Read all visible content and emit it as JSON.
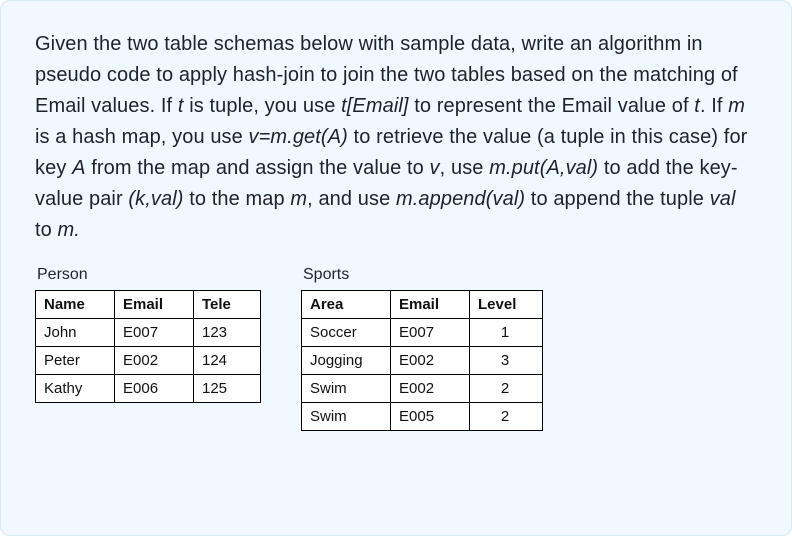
{
  "question": {
    "p1": "Given the two table schemas below with sample data,  write an algorithm in pseudo code to apply hash-join to join the two tables based on the matching of Email values. If ",
    "t_is_tuple_1": "t",
    "t_is_tuple_2": " is tuple, you use ",
    "t_email": "t[Email]",
    "p2": " to represent the Email value of ",
    "t2": "t",
    "p3": ". If ",
    "m1": "m",
    "p4": " is a hash map, you use ",
    "vgetA": "v=m.get(A)",
    "p5": " to retrieve the value (a tuple in this case) for key ",
    "A1": "A",
    "p6": " from the map and assign the value to ",
    "v1": "v",
    "p7": ",  use ",
    "mput": "m.put(A,val)",
    "p8": " to add the key-value pair ",
    "kval": "(k,val)",
    "p9": "  to the map ",
    "m2": "m",
    "p10": ", and use ",
    "mappend": "m.append(val)",
    "p11": " to append the tuple ",
    "val1": "val",
    "p12": " to ",
    "m3": "m.",
    "end": ""
  },
  "person": {
    "title": "Person",
    "headers": {
      "name": "Name",
      "email": "Email",
      "tele": "Tele"
    },
    "rows": [
      {
        "name": "John",
        "email": "E007",
        "tele": "123"
      },
      {
        "name": "Peter",
        "email": "E002",
        "tele": "124"
      },
      {
        "name": "Kathy",
        "email": "E006",
        "tele": "125"
      }
    ]
  },
  "sports": {
    "title": "Sports",
    "headers": {
      "area": "Area",
      "email": "Email",
      "level": "Level"
    },
    "rows": [
      {
        "area": "Soccer",
        "email": "E007",
        "level": "1"
      },
      {
        "area": "Jogging",
        "email": "E002",
        "level": "3"
      },
      {
        "area": "Swim",
        "email": "E002",
        "level": "2"
      },
      {
        "area": "Swim",
        "email": "E005",
        "level": "2"
      }
    ]
  }
}
